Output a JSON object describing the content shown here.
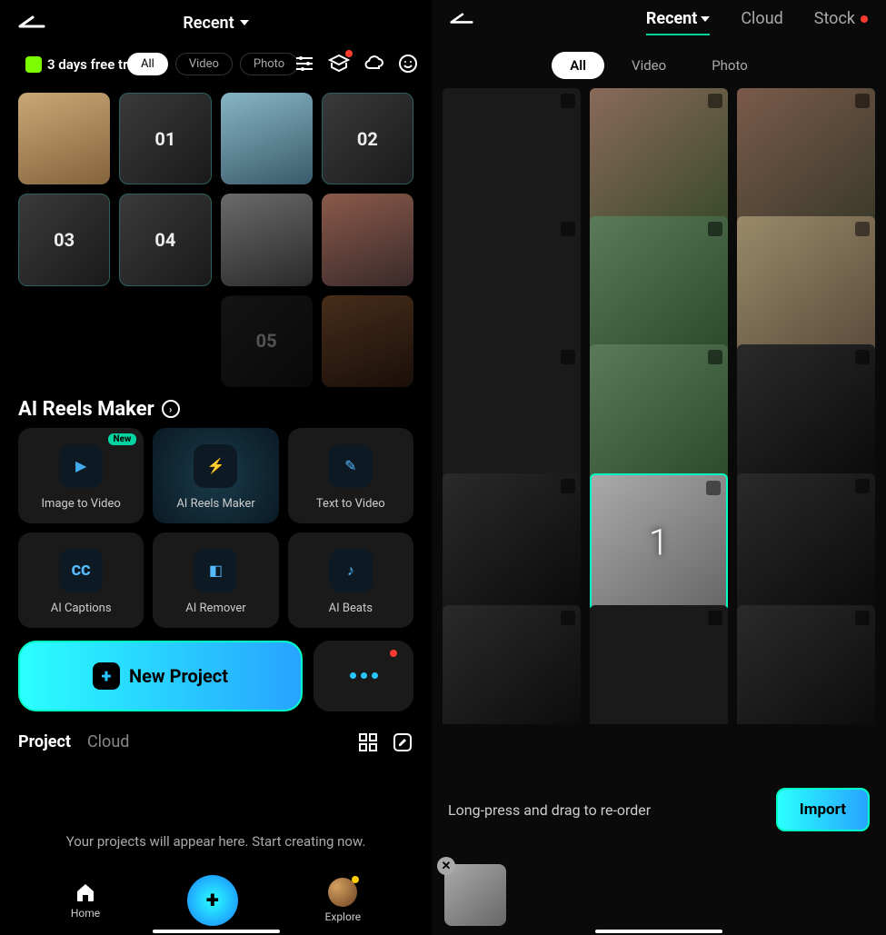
{
  "left": {
    "header_title": "Recent",
    "trial_text": "3 days free trial!",
    "filters": {
      "all": "All",
      "video": "Video",
      "photo": "Photo"
    },
    "thumbs": [
      "01",
      "02",
      "03",
      "04",
      "05"
    ],
    "section_title": "AI Reels Maker",
    "ai": {
      "image_to_video": "Image to Video",
      "reels_maker": "AI Reels Maker",
      "text_to_video": "Text  to Video",
      "captions": "AI Captions",
      "remover": "AI Remover",
      "beats": "AI Beats",
      "new_badge": "New"
    },
    "new_project": "New Project",
    "tabs": {
      "project": "Project",
      "cloud": "Cloud"
    },
    "empty": "Your projects will appear here. Start creating now.",
    "nav": {
      "home": "Home",
      "explore": "Explore"
    }
  },
  "right": {
    "tabs": {
      "recent": "Recent",
      "cloud": "Cloud",
      "stock": "Stock"
    },
    "chips": {
      "all": "All",
      "video": "Video",
      "photo": "Photo"
    },
    "selected_number": "1",
    "import_hint": "Long-press and drag to re-order",
    "import_button": "Import"
  },
  "colors": {
    "accent": "#00ffc3",
    "accent2": "#27a3ff",
    "danger": "#ff3b30"
  }
}
